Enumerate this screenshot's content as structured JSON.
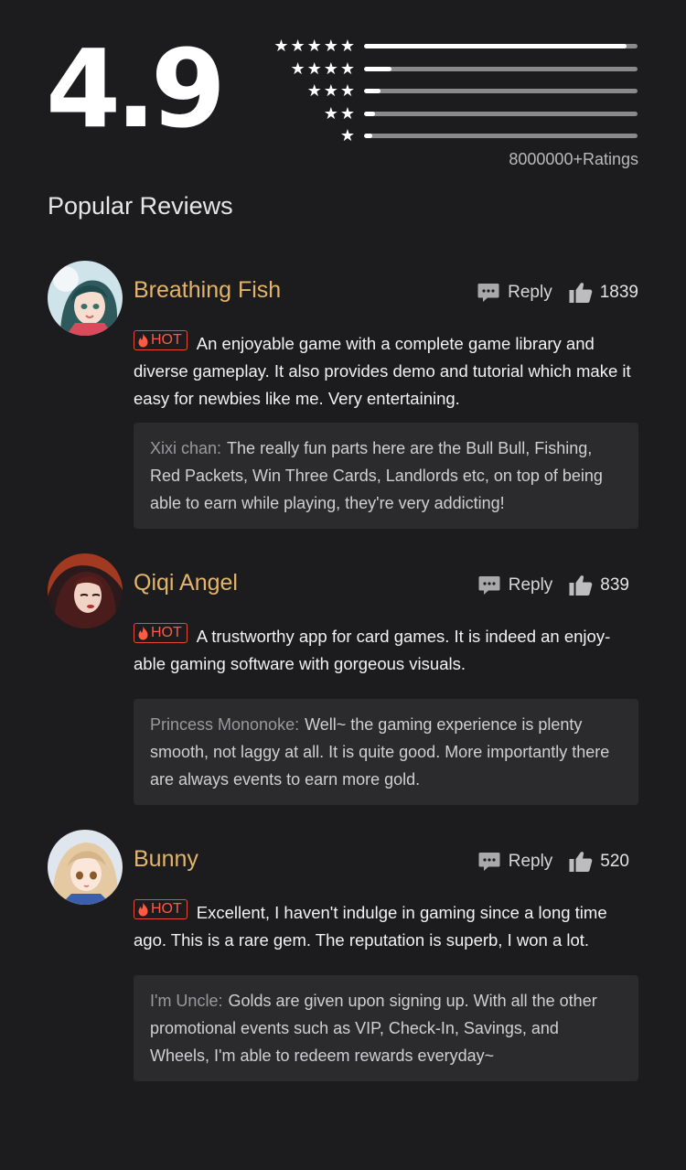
{
  "summary": {
    "score": "4.9",
    "ratings_count": "8000000+Ratings",
    "distribution": [
      {
        "stars": "★★★★★",
        "fraction": 0.96
      },
      {
        "stars": "★★★★",
        "fraction": 0.1
      },
      {
        "stars": "★★★",
        "fraction": 0.06
      },
      {
        "stars": "★★",
        "fraction": 0.04
      },
      {
        "stars": "★",
        "fraction": 0.03
      }
    ]
  },
  "section_title": "Popular Reviews",
  "reply_label": "Reply",
  "hot_label": "HOT",
  "colors": {
    "background": "#1c1b1e",
    "username": "#e2b56a",
    "hot": "#ff5a44",
    "reply_box": "#2b2a2d"
  },
  "reviews": [
    {
      "username": "Breathing Fish",
      "likes": "1839",
      "text": "An enjoyable game with a complete game library and diverse gameplay. It also provides demo and tutorial which make it easy for newbies like me. Very entertaining.",
      "reply": {
        "author": "Xixi chan:",
        "text": "The really fun parts here are the Bull Bull, Fishing, Red Packets, Win Three Cards, Landlords etc, on top of being able to earn while playing, they're very addicting!"
      }
    },
    {
      "username": "Qiqi Angel",
      "likes": "839",
      "text": "A trustworthy app for card games. It is indeed an enjoy-able gaming software with gorgeous visuals.",
      "reply": {
        "author": "Princess Mononoke:",
        "text": "Well~ the gaming experience is plenty smooth, not laggy at all. It is quite good. More importantly there are always events to earn more gold."
      }
    },
    {
      "username": "Bunny",
      "likes": "520",
      "text": "Excellent, I haven't indulge in gaming since a long time ago. This is a rare gem. The reputation is superb, I won a lot.",
      "reply": {
        "author": "I'm Uncle:",
        "text": "Golds are given upon signing up. With all the other promotional events such as VIP, Check-In, Savings, and Wheels, I'm able to redeem rewards everyday~"
      }
    }
  ]
}
